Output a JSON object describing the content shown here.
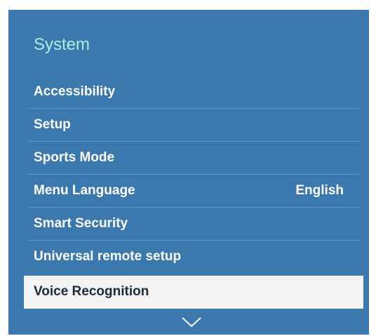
{
  "menu": {
    "title": "System",
    "items": [
      {
        "label": "Accessibility",
        "value": ""
      },
      {
        "label": "Setup",
        "value": ""
      },
      {
        "label": "Sports Mode",
        "value": ""
      },
      {
        "label": "Menu Language",
        "value": "English"
      },
      {
        "label": "Smart Security",
        "value": ""
      },
      {
        "label": "Universal remote setup",
        "value": ""
      },
      {
        "label": "Voice Recognition",
        "value": ""
      }
    ],
    "selected_index": 6,
    "scroll_indicator_icon": "chevron-down-icon"
  },
  "colors": {
    "panel_background": "#3a78ad",
    "title_text": "#a6f2e4",
    "item_text": "#ffffff",
    "selected_background": "#f3f3f3",
    "selected_text": "#1e2c3a"
  }
}
